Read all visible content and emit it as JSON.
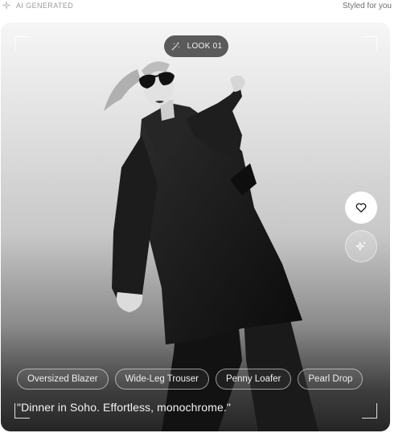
{
  "header": {
    "badge_label": "AI GENERATED",
    "badge_icon": "sparkle-icon",
    "right_label": "Styled for you"
  },
  "card": {
    "look_label": "LOOK 01",
    "look_icon": "magic-wand-icon",
    "actions": [
      {
        "icon": "heart-icon"
      },
      {
        "icon": "sparkles-icon"
      }
    ],
    "tags": [
      "Oversized Blazer",
      "Wide-Leg Trouser",
      "Penny Loafer",
      "Pearl Drop"
    ],
    "quote": "\"Dinner in Soho. Effortless, monochrome.\""
  },
  "colors": {
    "pill_bg": "#5a5a5a",
    "text_light": "#f4f4f4",
    "muted": "#9b9b9b"
  }
}
